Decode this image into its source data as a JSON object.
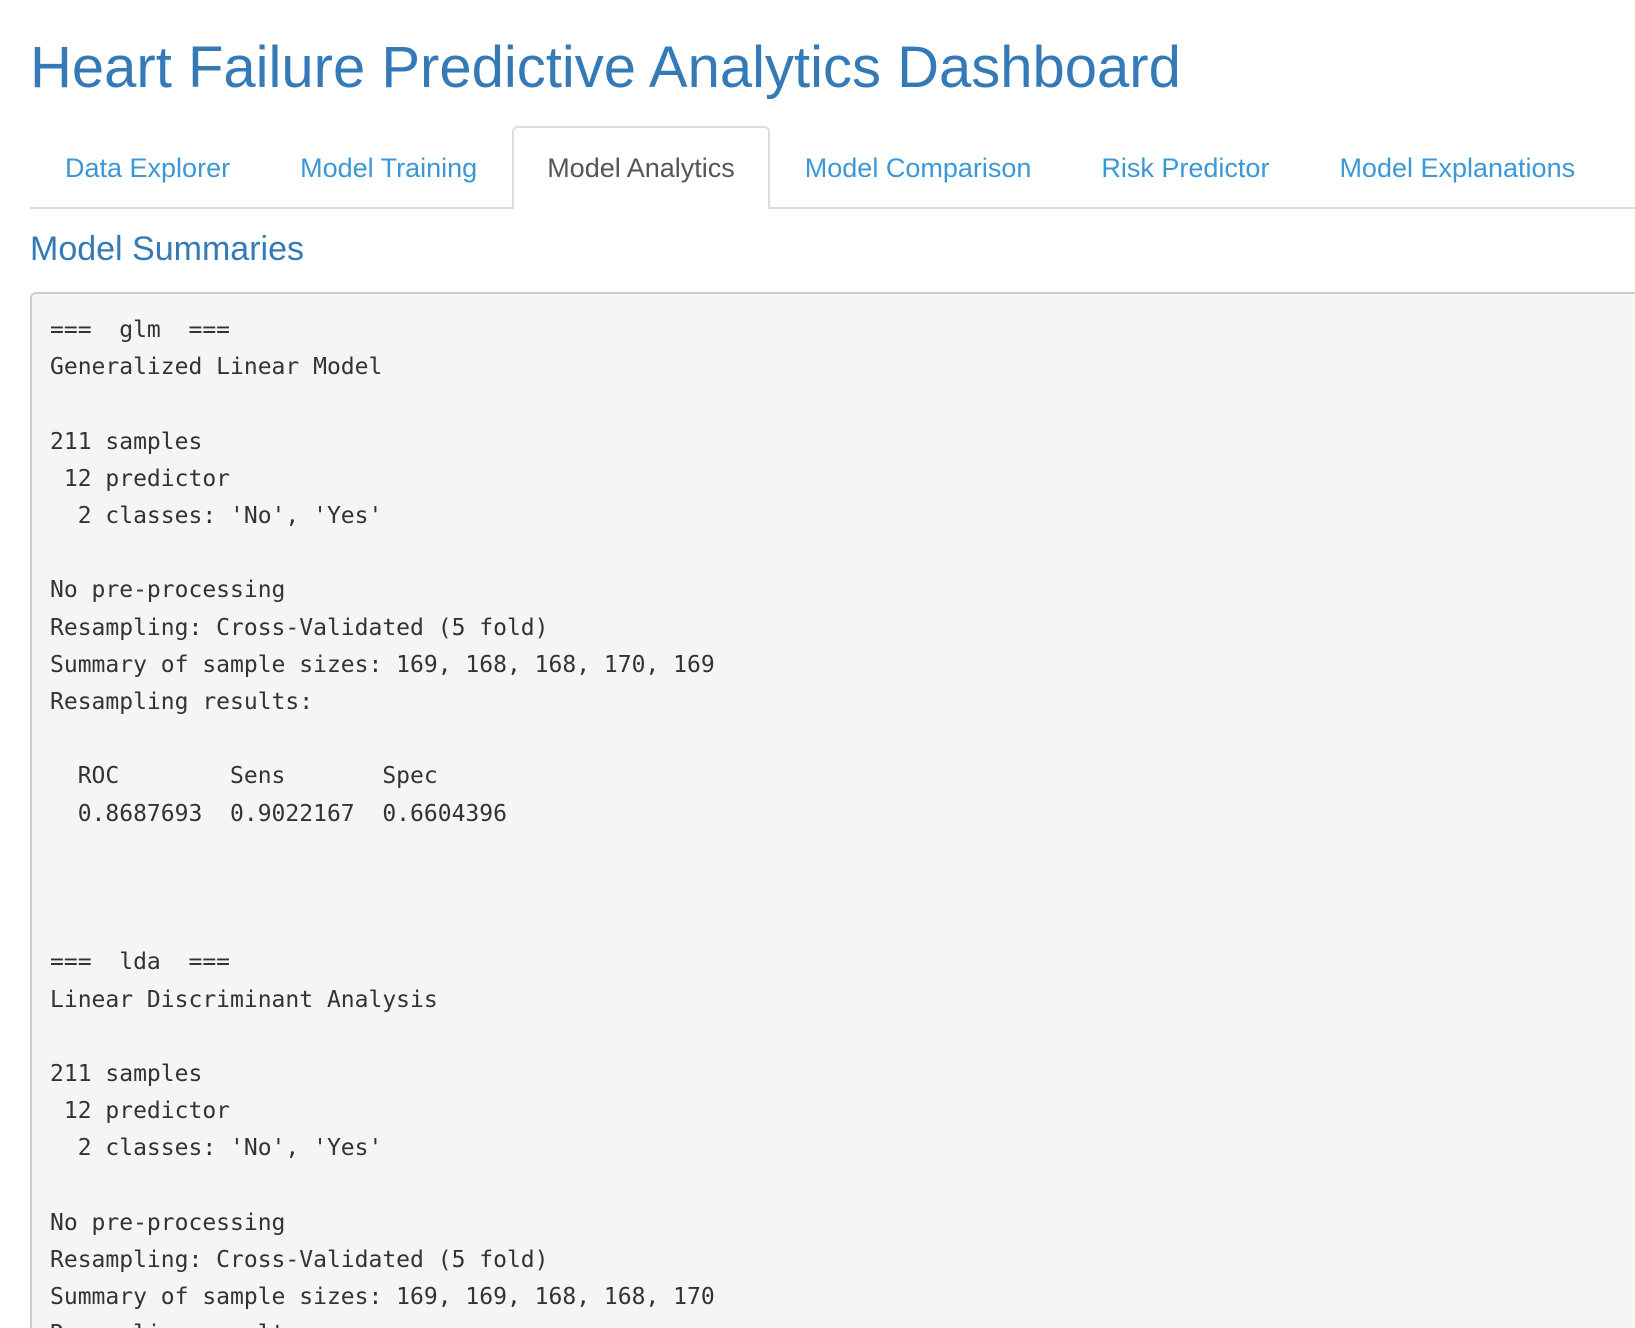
{
  "header": {
    "title": "Heart Failure Predictive Analytics Dashboard"
  },
  "tabs": [
    {
      "label": "Data Explorer",
      "active": false
    },
    {
      "label": "Model Training",
      "active": false
    },
    {
      "label": "Model Analytics",
      "active": true
    },
    {
      "label": "Model Comparison",
      "active": false
    },
    {
      "label": "Risk Predictor",
      "active": false
    },
    {
      "label": "Model Explanations",
      "active": false
    }
  ],
  "section": {
    "title": "Model Summaries"
  },
  "summary": {
    "text": "===  glm  ===\nGeneralized Linear Model\n\n211 samples\n 12 predictor\n  2 classes: 'No', 'Yes'\n\nNo pre-processing\nResampling: Cross-Validated (5 fold)\nSummary of sample sizes: 169, 168, 168, 170, 169\nResampling results:\n\n  ROC        Sens       Spec\n  0.8687693  0.9022167  0.6604396\n\n\n\n===  lda  ===\nLinear Discriminant Analysis\n\n211 samples\n 12 predictor\n  2 classes: 'No', 'Yes'\n\nNo pre-processing\nResampling: Cross-Validated (5 fold)\nSummary of sample sizes: 169, 169, 168, 168, 170\nResampling results:"
  },
  "colors": {
    "brand": "#337ab7",
    "tab_link": "#3c97d6",
    "active_tab_text": "#555555",
    "code_background": "#f5f5f5",
    "border": "#dddddd"
  }
}
